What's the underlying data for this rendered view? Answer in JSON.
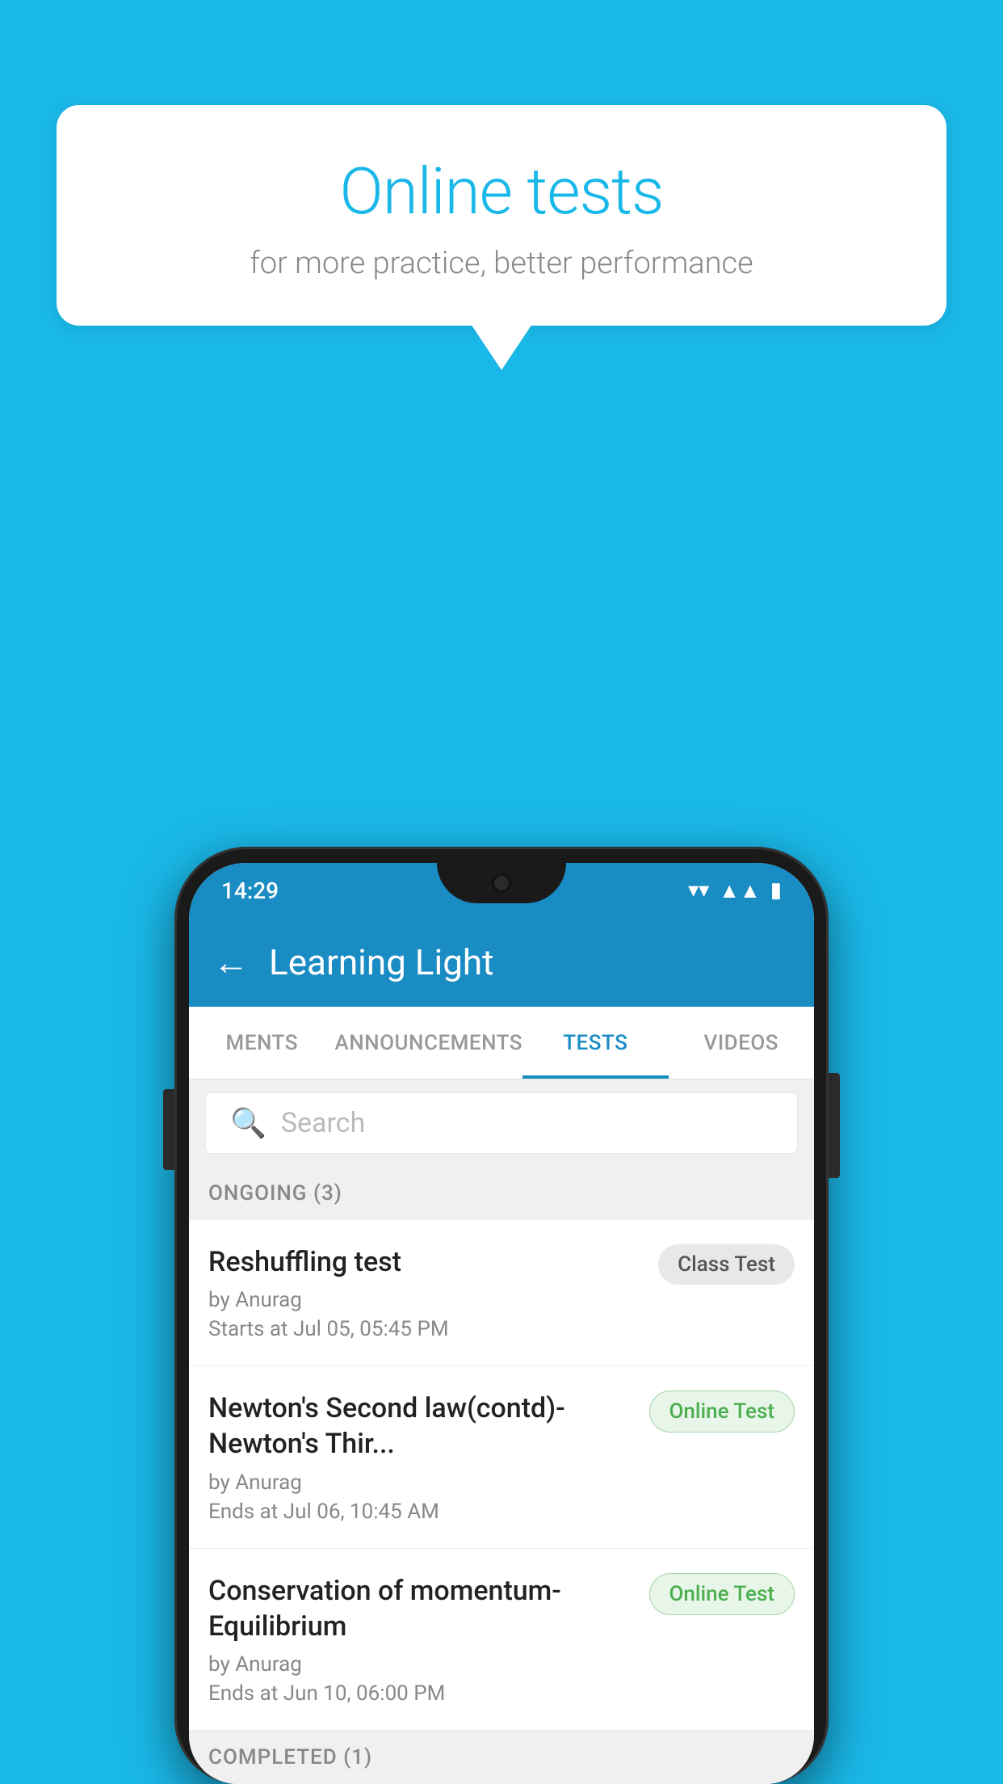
{
  "background": {
    "color": "#1ab8e8"
  },
  "speech_bubble": {
    "title": "Online tests",
    "subtitle": "for more practice, better performance"
  },
  "phone": {
    "status_bar": {
      "time": "14:29",
      "wifi": "▾",
      "signal": "▲",
      "battery": "▮"
    },
    "app_bar": {
      "back_label": "←",
      "title": "Learning Light"
    },
    "tabs": [
      {
        "label": "MENTS",
        "active": false
      },
      {
        "label": "ANNOUNCEMENTS",
        "active": false
      },
      {
        "label": "TESTS",
        "active": true
      },
      {
        "label": "VIDEOS",
        "active": false
      }
    ],
    "search": {
      "placeholder": "Search"
    },
    "sections": [
      {
        "label": "ONGOING (3)",
        "tests": [
          {
            "name": "Reshuffling test",
            "by": "by Anurag",
            "time": "Starts at  Jul 05, 05:45 PM",
            "badge": "Class Test",
            "badge_type": "class"
          },
          {
            "name": "Newton's Second law(contd)-Newton's Thir...",
            "by": "by Anurag",
            "time": "Ends at  Jul 06, 10:45 AM",
            "badge": "Online Test",
            "badge_type": "online"
          },
          {
            "name": "Conservation of momentum-Equilibrium",
            "by": "by Anurag",
            "time": "Ends at  Jun 10, 06:00 PM",
            "badge": "Online Test",
            "badge_type": "online"
          }
        ]
      }
    ],
    "completed_section_label": "COMPLETED (1)"
  }
}
